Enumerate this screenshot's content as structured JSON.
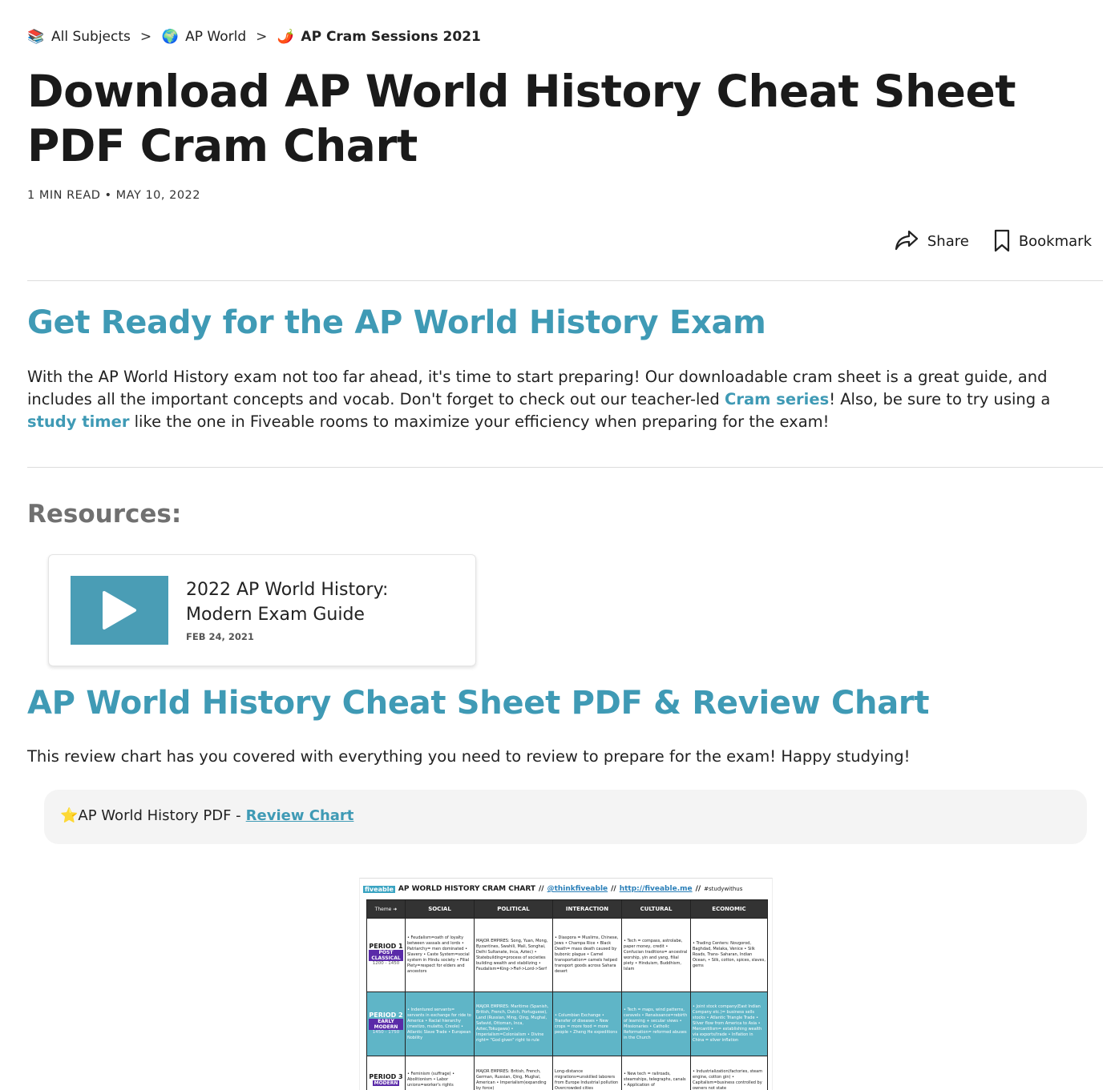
{
  "breadcrumb": {
    "items": [
      {
        "icon": "books-emoji",
        "glyph": "📚",
        "label": "All Subjects"
      },
      {
        "icon": "globe-emoji",
        "glyph": "🌍",
        "label": "AP World"
      },
      {
        "icon": "chili-emoji",
        "glyph": "🌶️",
        "label": "AP Cram Sessions 2021"
      }
    ],
    "separator": ">"
  },
  "article": {
    "title": "Download AP World History Cheat Sheet PDF Cram Chart",
    "meta": "1 MIN READ • MAY 10, 2022"
  },
  "actions": {
    "share": {
      "icon": "share-arrow-icon",
      "label": "Share"
    },
    "bookmark": {
      "icon": "bookmark-icon",
      "label": "Bookmark"
    }
  },
  "section1": {
    "heading": "Get Ready for the AP World History Exam",
    "text_1": "With the AP World History exam not too far ahead, it's time to start preparing! Our downloadable cram sheet is a great guide, and includes all the important concepts and vocab. Don't forget to check out our teacher-led ",
    "link_1": "Cram series",
    "text_2": "! Also, be sure to try using a ",
    "link_2": "study timer",
    "text_3": " like the one in Fiveable rooms to maximize your efficiency when preparing for the exam!"
  },
  "resources": {
    "heading": "Resources:",
    "card": {
      "icon": "play-icon",
      "title": "2022 AP World History: Modern Exam Guide",
      "date": "FEB 24, 2021"
    }
  },
  "section2": {
    "heading": "AP World History Cheat Sheet PDF & Review Chart",
    "text": "This review chart has you covered with everything you need to review to prepare for the exam! Happy studying!"
  },
  "callout": {
    "icon": "star-emoji",
    "glyph": "⭐",
    "text": "AP World History PDF - ",
    "link": "Review Chart"
  },
  "cram_chart": {
    "logo": "fiveable",
    "title": "AP WORLD HISTORY CRAM CHART",
    "sep": "//",
    "handle": "@thinkfiveable",
    "url": "http://fiveable.me",
    "hashtag": "#studywithus",
    "columns": [
      "Theme ➜",
      "SOCIAL",
      "POLITICAL",
      "INTERACTION",
      "CULTURAL",
      "ECONOMIC"
    ],
    "rows": [
      {
        "period": "PERIOD 1",
        "tag": "POST CLASSICAL",
        "years": "1200 - 1450",
        "cells": [
          "• Feudalism=oath of loyalty between vassals and lords • Patriarchy= men dominated • Slavery • Caste System=social system in Hindu society • Filial Piety=respect for elders and ancestors",
          "MAJOR EMPIRES: Song, Yuan, Mong, Byzantines, Swahili, Mali, Songhai, Delhi Sultanate, Inca, Aztec) • Statebuilding=process of societies building wealth and stabilizing • Feudalism=King->Fief->Lord->Serf",
          "• Diaspora = Muslims, Chinese, Jews • Champa Rice • Black Death= mass death caused by bubonic plague • Camel transportation= camels helped transport goods across Sahara desert",
          "• Tech = compass, astrolabe, paper money, credit • Confucian traditions= ancestral worship, yin and yang, filial piety • Hinduism, Buddhism, Islam",
          "• Trading Centers: Novgorod, Baghdad, Melaka, Venice • Silk Roads, Trans- Saharan, Indian Ocean, • Silk, cotton, spices, slaves, gems"
        ]
      },
      {
        "period": "PERIOD 2",
        "tag": "EARLY MODERN",
        "years": "1450 - 1750",
        "cells": [
          "• Indentured servants= servants in exchange for ride to America • Racial hierarchy (mestizo, mulatto, Creole) • Atlantic Slave Trade • European Nobility",
          "MAJOR EMPIRES: Maritime (Spanish, British, French, Dutch, Portuguese), Land (Russian, Ming, Qing, Mughal, Safavid, Ottoman, Inca, Aztec,Tokugawa) • Imperialism=Colonialism • Divine right= \"God given\" right to rule",
          "• Columbian Exchange • Transfer of diseases • New crops = more food = more people • Zheng He expeditions",
          "• Tech = maps, wind patterns, caravels • Renaissance=rebirth of learning + secular views • Missionaries • Catholic Reformation= reformed abuses in the Church",
          "• Joint stock company(East Indian Company etc.)= business sells stocks • Atlantic Triangle Trade • Silver flow from America to Asia • Mercantilism= establishing wealth via exports/trade • Inflation in China = silver inflation"
        ]
      },
      {
        "period": "PERIOD 3",
        "tag": "MODERN",
        "years": "",
        "cells": [
          "• Feminism (suffrage) • Abolitionism • Labor unions=worker's rights",
          "MAJOR EMPIRES: British, French, German, Russian, Qing, Mughal, American • Imperialism(expanding by force)",
          "Long-distance migrations=unskilled laborers from Europe Industrial pollution Overcrowded cities",
          "• New tech = railroads, steamships, telegraphs, canals • Application of",
          "• Industrialization(factories, steam engine, cotton gin) • Capitalism=business controlled by owners not state"
        ]
      }
    ]
  }
}
